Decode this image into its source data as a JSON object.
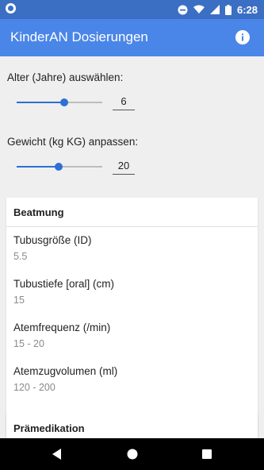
{
  "status_bar": {
    "time": "6:28",
    "icons": [
      "do-not-disturb-icon",
      "wifi-icon",
      "cell-signal-icon",
      "battery-icon"
    ]
  },
  "app_bar": {
    "title": "KinderAN Dosierungen",
    "info_icon": "info-icon"
  },
  "age": {
    "label": "Alter (Jahre) auswählen:",
    "value": "6",
    "slider_level": 0.56
  },
  "weight": {
    "label": "Gewicht (kg KG) anpassen:",
    "value": "20",
    "slider_level": 0.49
  },
  "beatmung": {
    "header": "Beatmung",
    "rows": [
      {
        "label": "Tubusgröße (ID)",
        "value": "5.5"
      },
      {
        "label": "Tubustiefe [oral] (cm)",
        "value": "15"
      },
      {
        "label": "Atemfrequenz (/min)",
        "value": "15 - 20"
      },
      {
        "label": "Atemzugvolumen (ml)",
        "value": "120 - 200"
      }
    ]
  },
  "praemedikation": {
    "header": "Prämedikation"
  },
  "nav_bar": {
    "icons": [
      "back-icon",
      "home-icon",
      "recents-icon"
    ]
  },
  "colors": {
    "status_bar": "#3b6fc4",
    "app_bar": "#4a86e8",
    "accent": "#2d6fd6",
    "background": "#efefef"
  }
}
